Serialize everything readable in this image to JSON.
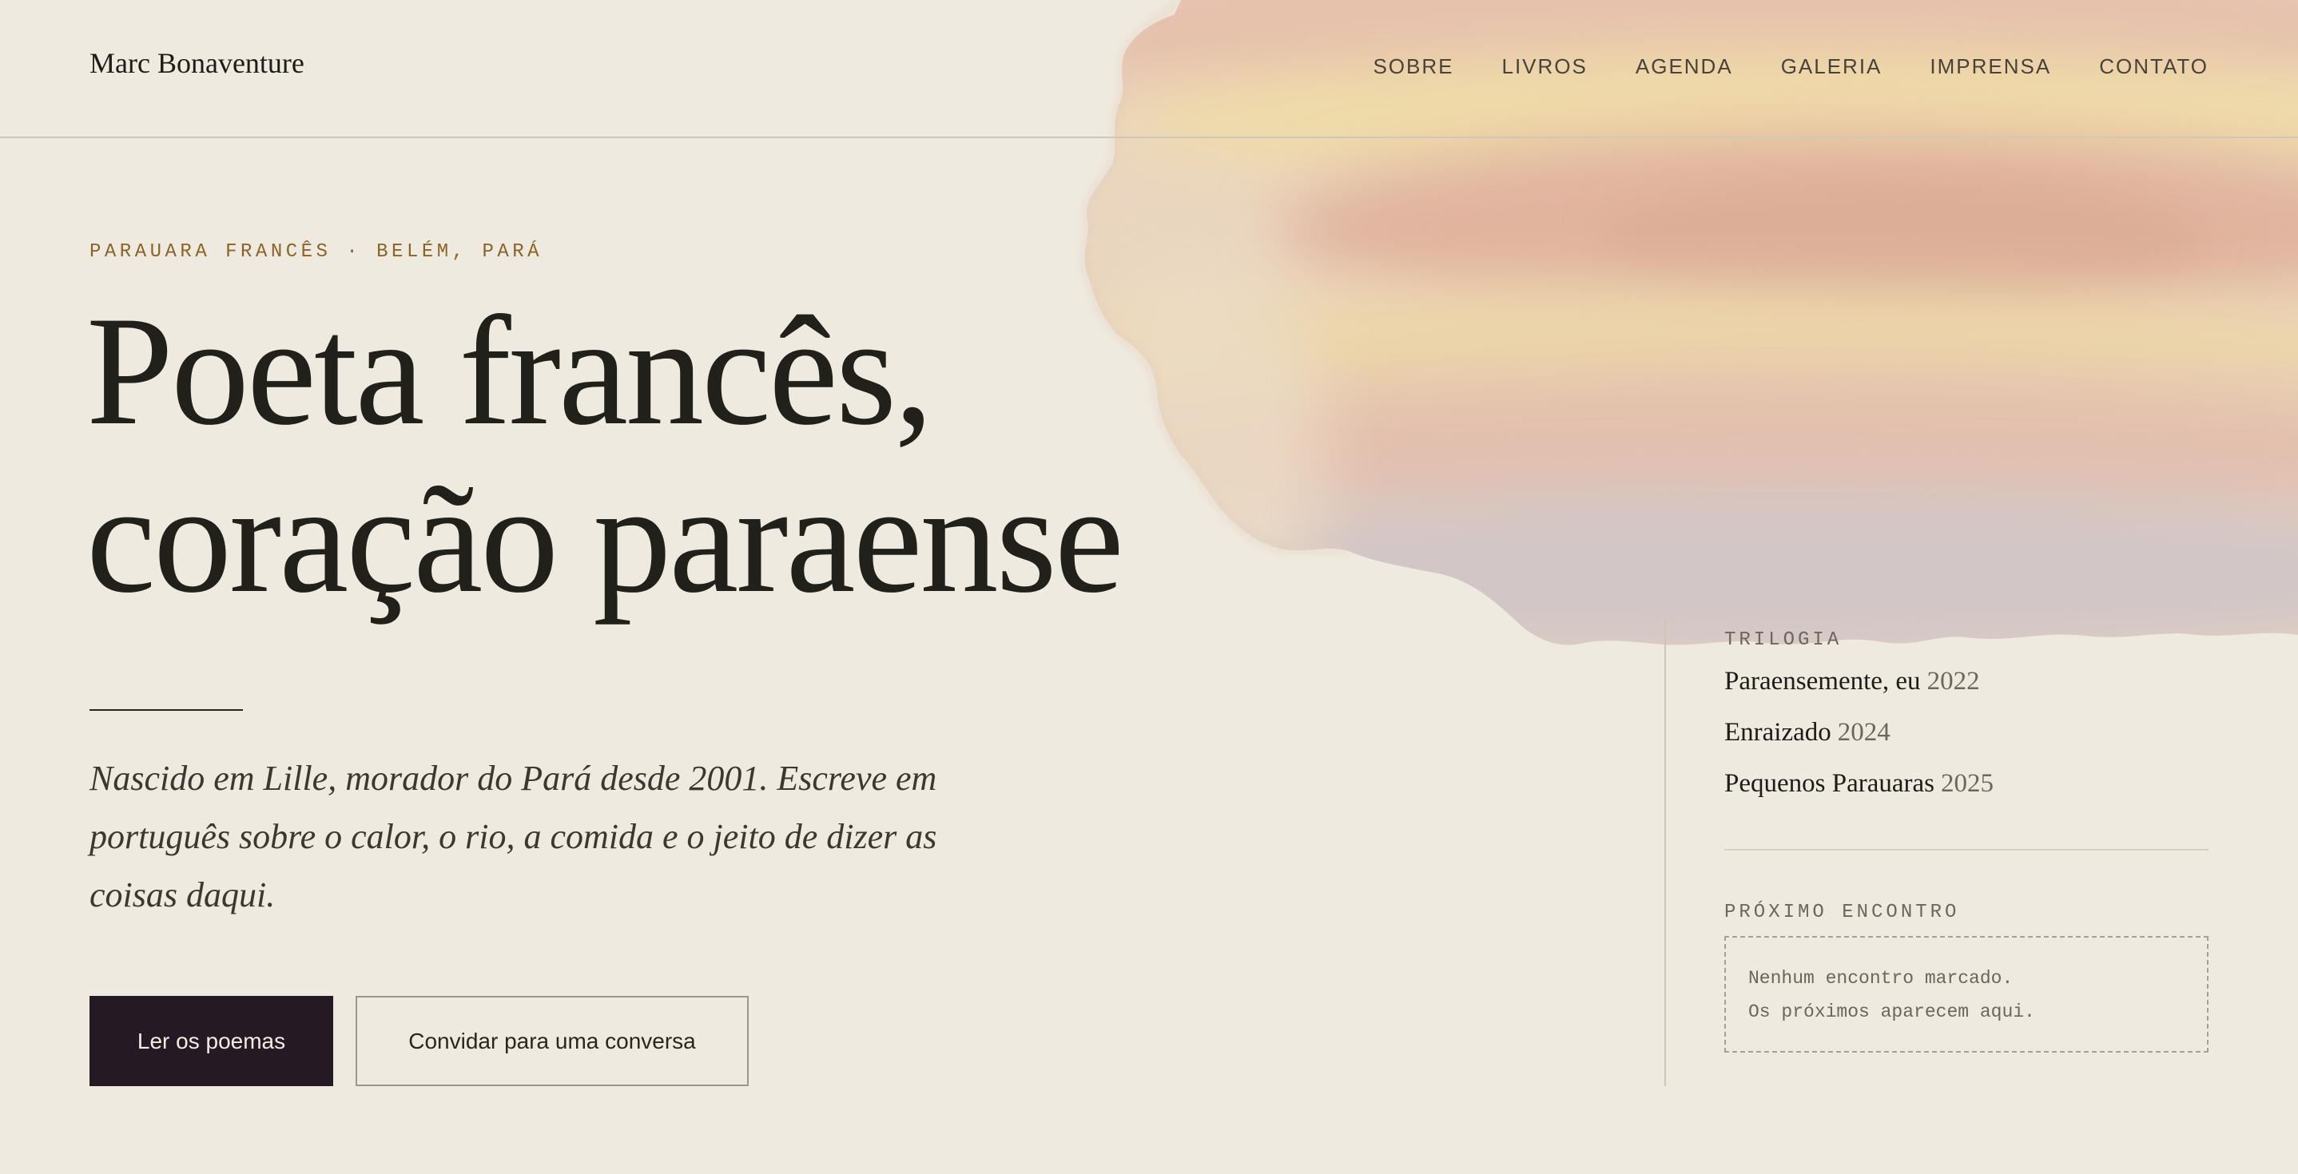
{
  "site": {
    "brand": "Marc Bonaventure"
  },
  "nav": {
    "items": [
      "SOBRE",
      "LIVROS",
      "AGENDA",
      "GALERIA",
      "IMPRENSA",
      "CONTATO"
    ]
  },
  "hero": {
    "eyebrow": "PARAUARA FRANCÊS · BELÉM, PARÁ",
    "headline_line1": "Poeta francês,",
    "headline_line2": "coração paraense",
    "lede": "Nascido em Lille, morador do Pará desde 2001. Escreve em português sobre o calor, o rio, a comida e o jeito de dizer as coisas daqui.",
    "primary_button": "Ler os poemas",
    "secondary_button": "Convidar para uma conversa"
  },
  "sidebar": {
    "trilogy_label": "TRILOGIA",
    "books": [
      {
        "title": "Paraensemente, eu",
        "year": "2022"
      },
      {
        "title": "Enraizado",
        "year": "2024"
      },
      {
        "title": "Pequenos Parauaras",
        "year": "2025"
      }
    ],
    "next_label": "PRÓXIMO ENCONTRO",
    "next_line1": "Nenhum encontro marcado.",
    "next_line2": "Os próximos aparecem aqui."
  },
  "colors": {
    "background": "#efeadf",
    "ink": "#1f1c17",
    "accent": "#8a6327",
    "primary_button": "#231a24",
    "watercolor_peach": "#e2b8a0",
    "watercolor_yellow": "#eed9a4",
    "watercolor_lilac": "#cfc1c3"
  }
}
